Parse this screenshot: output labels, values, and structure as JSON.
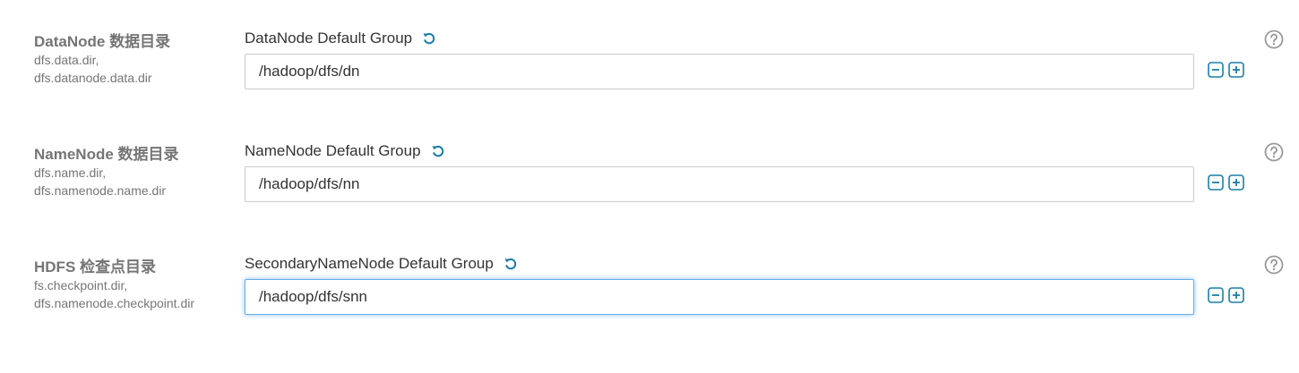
{
  "colors": {
    "accent": "#1a7fa6",
    "label_gray": "#757575",
    "text": "#333333",
    "border": "#cccccc",
    "focus": "#66afe9",
    "help_icon": "#999999"
  },
  "rows": [
    {
      "name": "DataNode 数据目录",
      "keys": [
        "dfs.data.dir,",
        "dfs.datanode.data.dir"
      ],
      "group": "DataNode Default Group",
      "value": "/hadoop/dfs/dn",
      "icons": {
        "revert": "undo-icon",
        "remove": "minus-square-icon",
        "add": "plus-square-icon",
        "help": "question-circle-icon"
      }
    },
    {
      "name": "NameNode 数据目录",
      "keys": [
        "dfs.name.dir,",
        "dfs.namenode.name.dir"
      ],
      "group": "NameNode Default Group",
      "value": "/hadoop/dfs/nn",
      "icons": {
        "revert": "undo-icon",
        "remove": "minus-square-icon",
        "add": "plus-square-icon",
        "help": "question-circle-icon"
      }
    },
    {
      "name": "HDFS 检查点目录",
      "keys": [
        "fs.checkpoint.dir,",
        "dfs.namenode.checkpoint.dir"
      ],
      "group": "SecondaryNameNode Default Group",
      "value": "/hadoop/dfs/snn",
      "focused": true,
      "icons": {
        "revert": "undo-icon",
        "remove": "minus-square-icon",
        "add": "plus-square-icon",
        "help": "question-circle-icon"
      }
    }
  ]
}
